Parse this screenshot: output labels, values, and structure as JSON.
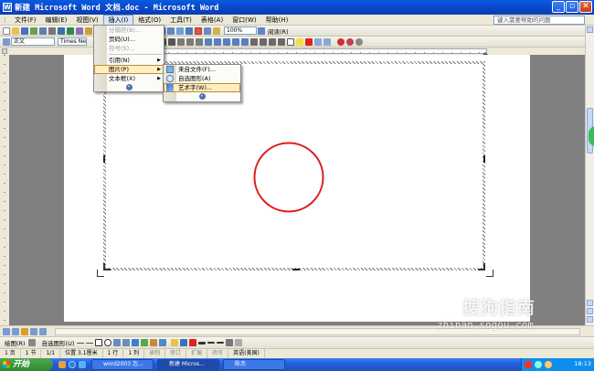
{
  "window": {
    "title": "新建 Microsoft Word 文档.doc - Microsoft Word",
    "app_icon": "W"
  },
  "menubar": {
    "items": [
      "文件(F)",
      "编辑(E)",
      "视图(V)",
      "插入(I)",
      "格式(O)",
      "工具(T)",
      "表格(A)",
      "窗口(W)",
      "帮助(H)"
    ],
    "open_index": 3,
    "help_placeholder": "键入需要帮助的问题"
  },
  "toolbar": {
    "style": "正文",
    "font": "Times New",
    "zoom": "100%",
    "read_button": "阅读(R)"
  },
  "insert_menu": {
    "items": [
      {
        "label": "分隔符(B)...",
        "disabled": true,
        "submenu": false
      },
      {
        "label": "页码(U)...",
        "disabled": false,
        "submenu": false
      },
      {
        "label": "符号(S)...",
        "disabled": true,
        "submenu": false
      },
      {
        "label": "引用(N)",
        "disabled": false,
        "submenu": true
      },
      {
        "label": "图片(P)",
        "disabled": false,
        "submenu": true,
        "highlighted": true
      },
      {
        "label": "文本框(X)",
        "disabled": false,
        "submenu": true
      }
    ],
    "more": "»"
  },
  "picture_menu": {
    "items": [
      {
        "label": "来自文件(F)...",
        "icon": "picture-from-file-icon"
      },
      {
        "label": "自选图形(A)",
        "icon": "autoshape-icon"
      },
      {
        "label": "艺术字(W)...",
        "icon": "wordart-icon",
        "highlighted": true
      }
    ],
    "more": "»"
  },
  "document": {
    "shape": "circle",
    "shape_color": "#dd1c1c"
  },
  "drawing_toolbar": {
    "draw_label": "绘图(R)",
    "autoshapes_label": "自选图形(U)"
  },
  "statusbar": {
    "page": "1 页",
    "section": "1 节",
    "pages": "1/1",
    "position": "位置 3.1厘米",
    "line": "1 行",
    "column": "1 列",
    "rec": "录制",
    "trk": "修订",
    "ext": "扩展",
    "ovr": "改写",
    "lang": "英语(美国)"
  },
  "taskbar": {
    "start": "开始",
    "tasks": [
      {
        "label": "word2003 怎...",
        "active": false
      },
      {
        "label": "新建 Micros...",
        "active": true
      },
      {
        "label": "陈杰",
        "active": false
      }
    ],
    "clock": "18:13"
  },
  "watermark": {
    "text": "搜狗指南",
    "url": "zhinan.sogou.com"
  }
}
